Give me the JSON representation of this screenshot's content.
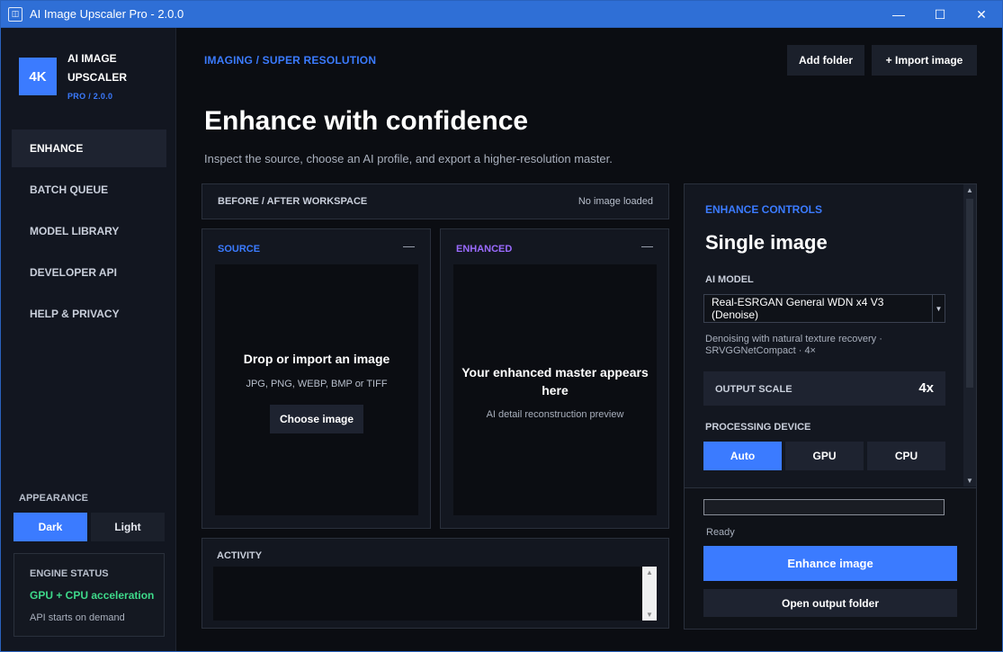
{
  "window": {
    "title": "AI Image Upscaler Pro - 2.0.0",
    "minimize": "—",
    "maximize": "☐",
    "close": "✕"
  },
  "sidebar": {
    "logo_text": "4K",
    "brand_name": "AI IMAGE UPSCALER",
    "brand_version": "PRO / 2.0.0",
    "nav": [
      {
        "label": "ENHANCE",
        "active": true
      },
      {
        "label": "BATCH QUEUE"
      },
      {
        "label": "MODEL LIBRARY"
      },
      {
        "label": "DEVELOPER API"
      },
      {
        "label": "HELP & PRIVACY"
      }
    ],
    "appearance_label": "APPEARANCE",
    "theme_dark": "Dark",
    "theme_light": "Light",
    "engine_title": "ENGINE STATUS",
    "engine_status": "GPU + CPU acceleration",
    "engine_note": "API starts on demand"
  },
  "header": {
    "breadcrumb": "IMAGING / SUPER RESOLUTION",
    "add_folder": "Add folder",
    "import_image": "+ Import image",
    "title": "Enhance with confidence",
    "subtitle": "Inspect the source, choose an AI profile, and export a higher-resolution master."
  },
  "workspace": {
    "label": "BEFORE / AFTER WORKSPACE",
    "status": "No image loaded",
    "source": {
      "label": "SOURCE",
      "collapse": "—",
      "title": "Drop or import an image",
      "formats": "JPG, PNG, WEBP, BMP or TIFF",
      "button": "Choose image"
    },
    "enhanced": {
      "label": "ENHANCED",
      "collapse": "—",
      "title": "Your enhanced master appears here",
      "subtitle": "AI detail reconstruction preview"
    },
    "activity_label": "ACTIVITY"
  },
  "controls": {
    "kicker": "ENHANCE CONTROLS",
    "title": "Single image",
    "ai_model_label": "AI MODEL",
    "ai_model_value": "Real-ESRGAN General WDN x4 V3 (Denoise)",
    "model_description": "Denoising with natural texture recovery · SRVGGNetCompact · 4×",
    "output_scale_label": "OUTPUT SCALE",
    "output_scale_value": "4x",
    "device_label": "PROCESSING DEVICE",
    "devices": [
      {
        "label": "Auto",
        "active": true
      },
      {
        "label": "GPU"
      },
      {
        "label": "CPU"
      }
    ],
    "progress": 0,
    "status": "Ready",
    "enhance_button": "Enhance image",
    "output_button": "Open output folder"
  },
  "colors": {
    "accent": "#3b7bff",
    "enhanced_accent": "#9b6bff",
    "success": "#3ed98a",
    "titlebar": "#2f6fd6"
  }
}
